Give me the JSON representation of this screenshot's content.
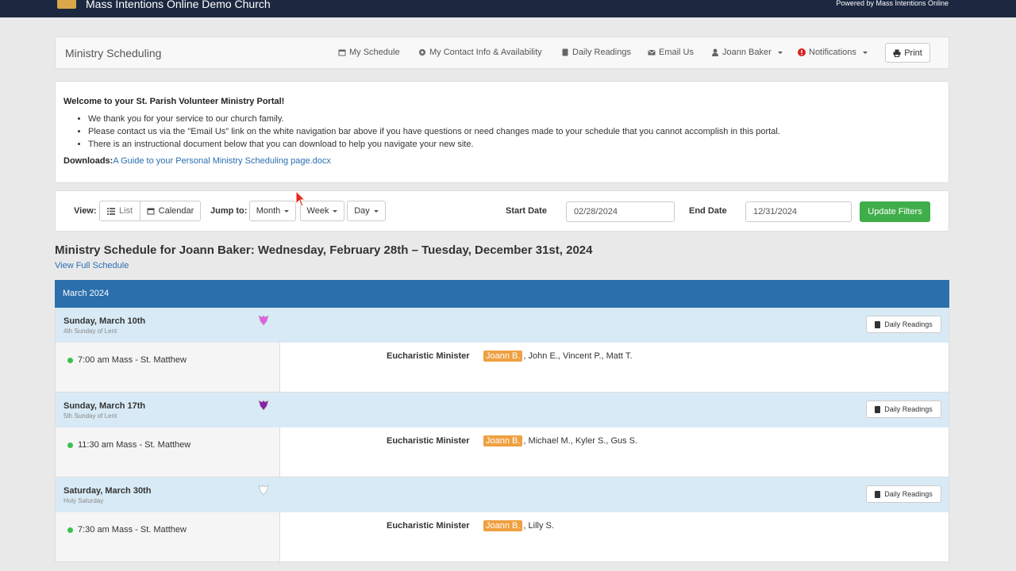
{
  "topbar": {
    "brand": "Mass Intentions Online Demo Church",
    "powered": "Powered by Mass Intentions Online"
  },
  "navbar": {
    "title": "Ministry Scheduling",
    "items": [
      {
        "label": "My Schedule",
        "icon": "calendar-icon"
      },
      {
        "label": "My Contact Info & Availability",
        "icon": "gear-icon"
      },
      {
        "label": "Daily Readings",
        "icon": "book-icon"
      },
      {
        "label": "Email Us",
        "icon": "envelope-icon"
      },
      {
        "label": "Joann Baker",
        "icon": "user-icon"
      },
      {
        "label": "Notifications",
        "icon": "alert-icon"
      }
    ],
    "print": "Print"
  },
  "welcome": {
    "heading": "Welcome to your St. Parish Volunteer Ministry Portal!",
    "bullets": [
      "We thank you for your service to our church family.",
      "Please contact us via the \"Email Us\" link on the white navigation bar above if you have questions or need changes made to your schedule that you cannot accomplish in this portal.",
      "There is an instructional document below that you can download to help you navigate your new site."
    ],
    "downloads_label": "Downloads:",
    "download_link": "A Guide to your Personal Ministry Scheduling page.docx"
  },
  "filters": {
    "view_label": "View:",
    "list": "List",
    "calendar": "Calendar",
    "jump_label": "Jump to:",
    "month": "Month",
    "week": "Week",
    "day": "Day",
    "start_label": "Start Date",
    "start_value": "02/28/2024",
    "end_label": "End Date",
    "end_value": "12/31/2024",
    "update": "Update Filters"
  },
  "schedule": {
    "title": "Ministry Schedule for Joann Baker: Wednesday, February 28th – Tuesday, December 31st, 2024",
    "view_full": "View Full Schedule",
    "month": "March 2024",
    "daily_readings": "Daily Readings",
    "days": [
      {
        "date": "Sunday, March 10th",
        "liturgy": "4th Sunday of Lent",
        "vestment_color": "#e25ee6",
        "mass": "7:00 am Mass - St. Matthew",
        "role": "Eucharistic Minister",
        "me": "Joann B.",
        "others": ", John E., Vincent P., Matt T."
      },
      {
        "date": "Sunday, March 17th",
        "liturgy": "5th Sunday of Lent",
        "vestment_color": "#8a1fa8",
        "mass": "11:30 am Mass - St. Matthew",
        "role": "Eucharistic Minister",
        "me": "Joann B.",
        "others": ", Michael M., Kyler S., Gus S."
      },
      {
        "date": "Saturday, March 30th",
        "liturgy": "Holy Saturday",
        "vestment_color": "#ffffff",
        "mass": "7:30 am Mass - St. Matthew",
        "role": "Eucharistic Minister",
        "me": "Joann B.",
        "others": ", Lilly S."
      }
    ]
  }
}
